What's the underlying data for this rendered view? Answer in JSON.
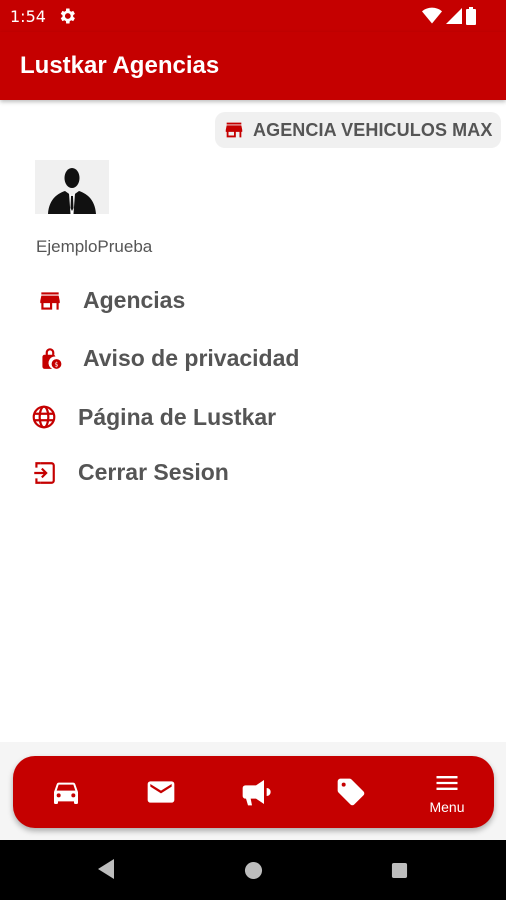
{
  "status_bar": {
    "time": "1:54"
  },
  "app_bar": {
    "title": "Lustkar Agencias"
  },
  "agency": {
    "name": "AGENCIA VEHICULOS MAX"
  },
  "user": {
    "name": "EjemploPrueba"
  },
  "menu": {
    "items": [
      {
        "label": "Agencias",
        "icon": "store-icon"
      },
      {
        "label": "Aviso de privacidad",
        "icon": "lock-privacy-icon"
      },
      {
        "label": "Página de Lustkar",
        "icon": "globe-icon"
      },
      {
        "label": "Cerrar Sesion",
        "icon": "logout-icon"
      }
    ]
  },
  "bottom_nav": {
    "items": [
      {
        "icon": "car-icon"
      },
      {
        "icon": "mail-icon"
      },
      {
        "icon": "megaphone-icon"
      },
      {
        "icon": "tag-icon"
      },
      {
        "icon": "menu-icon",
        "label": "Menu"
      }
    ]
  },
  "colors": {
    "primary": "#c50000",
    "text": "#555555",
    "chip_bg": "#f0f0f0"
  }
}
